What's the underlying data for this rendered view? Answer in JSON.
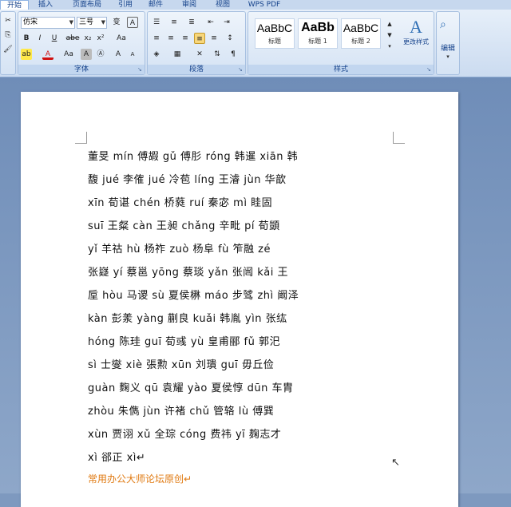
{
  "tabs": [
    "开始",
    "插入",
    "页面布局",
    "引用",
    "邮件",
    "审阅",
    "视图",
    "WPS PDF"
  ],
  "font_group": {
    "label": "字体",
    "font_name": "仿宋",
    "font_size": "三号",
    "buttons": [
      "B",
      "I",
      "U",
      "abe",
      "x₂",
      "x²",
      "Aa",
      "A",
      "A",
      "Ⓐ",
      "A",
      "A"
    ],
    "clear_label": "变",
    "char_border": "A"
  },
  "paragraph_group": {
    "label": "段落"
  },
  "styles_group": {
    "label": "样式",
    "styles": [
      {
        "sample": "AaBbC",
        "name": "标题"
      },
      {
        "sample": "AaBb",
        "name": "标题 1"
      },
      {
        "sample": "AaBbC",
        "name": "标题 2"
      }
    ],
    "change_styles": "更改样式"
  },
  "edit_group": {
    "label": "编辑"
  },
  "document": {
    "lines": [
      "董旻  mín  傅嘏  gǔ  傅肜  róng  韩暹  xiān  韩",
      "馥  jué  李傕  jué  冷苞  líng  王濬  jùn  华歆",
      "xīn  荀谌  chén  桥蕤  ruí  秦宓  mì  眭固",
      "suī  王粲  càn  王昶  chǎng  辛毗  pí  荀顗",
      "yǐ  羊祜  hù  杨祚  zuò  杨阜  fù  笮融  zé",
      "张嶷  yí  蔡邕  yōng  蔡琰  yǎn  张闿  kǎi  王",
      "垕  hòu  马谡  sù  夏侯楙  máo  步骘  zhì  阚泽",
      "kàn  彭羕  yàng  蒯良  kuǎi  韩胤  yìn  张纮",
      "hóng  陈珪  guī  荀彧  yù  皇甫郦  fǔ  郭汜",
      "sì  士燮  xiè  張勲  xūn  刘璝  guī  毋丘俭",
      "guàn  麴义  qū  袁耀  yào  夏侯惇  dūn  车胄",
      "zhòu  朱儁  jùn  许褚  chǔ  管辂  lù  傅巽",
      "xùn  贾诩  xǔ  全琮  cóng  费祎  yī  麹志才",
      "xì  郤正  xì↵"
    ],
    "source_note": "常用办公大师论坛原创↵"
  }
}
